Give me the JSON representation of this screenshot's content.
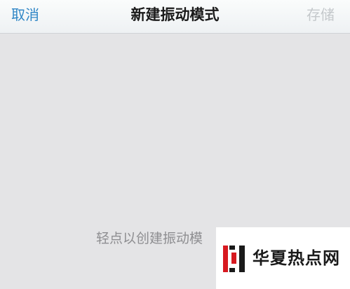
{
  "navbar": {
    "cancel_label": "取消",
    "title": "新建振动模式",
    "save_label": "存储"
  },
  "canvas": {
    "hint": "轻点以创建振动模"
  },
  "watermark": {
    "text": "华夏热点网"
  },
  "colors": {
    "accent": "#2f86c6",
    "disabled": "#c4c8cb",
    "background": "#e4e4e6",
    "logo_red": "#d71920"
  }
}
